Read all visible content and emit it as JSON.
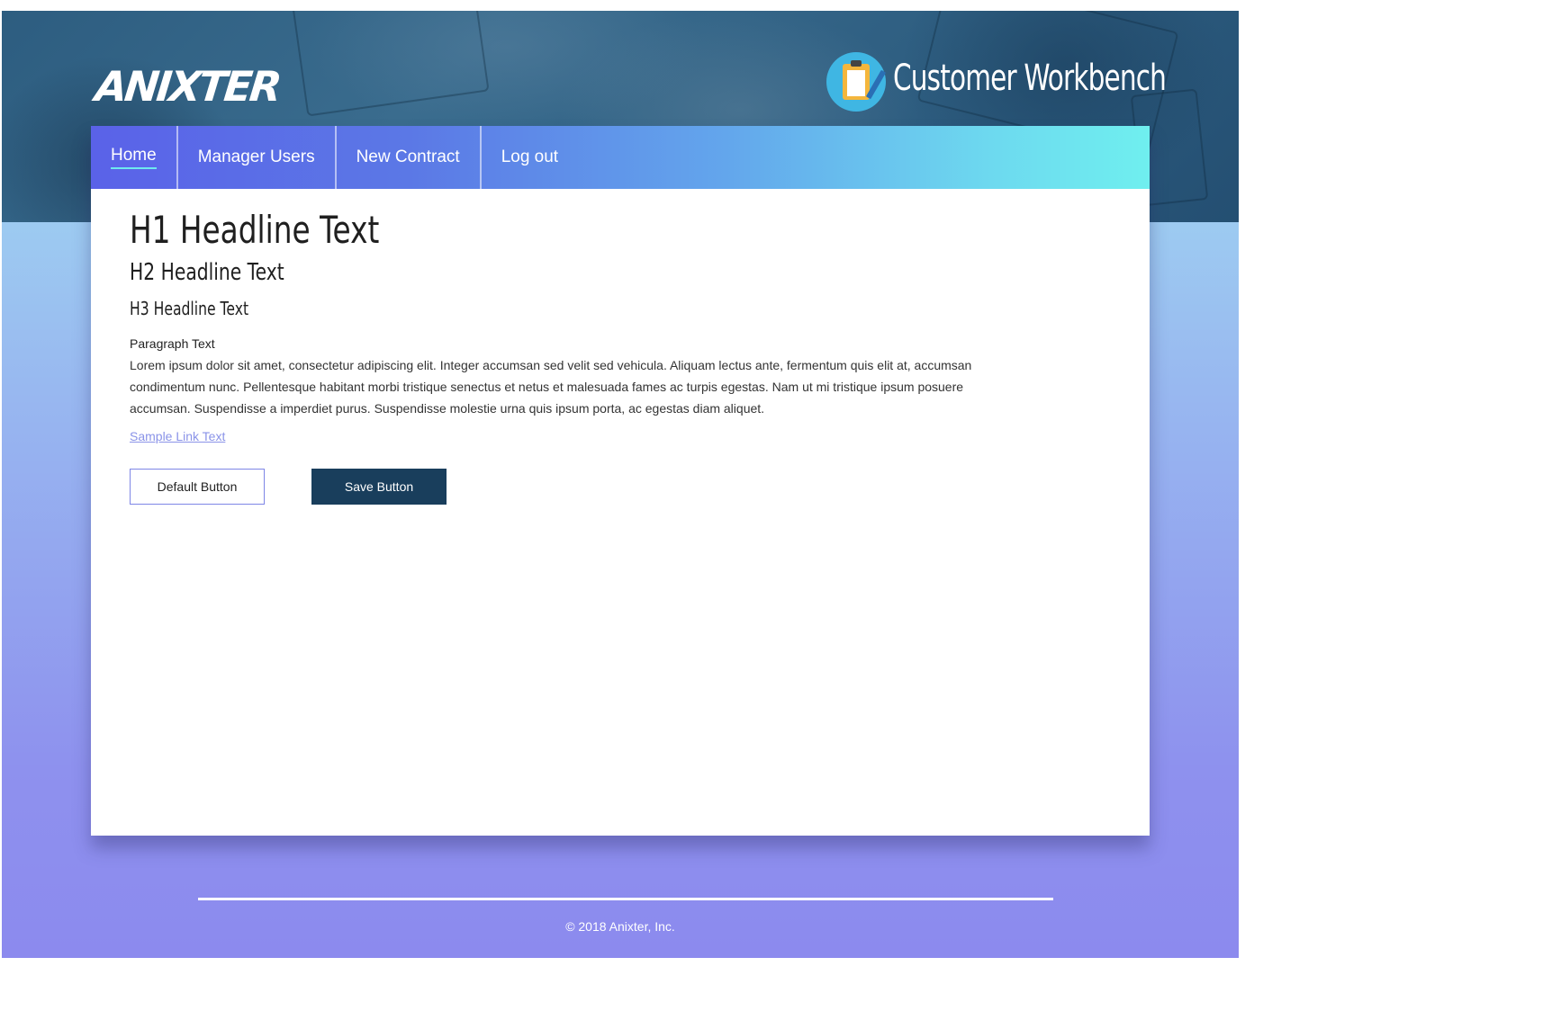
{
  "header": {
    "logo_text": "ANIXTER",
    "app_title": "Customer Workbench",
    "app_icon": "clipboard-icon"
  },
  "nav": {
    "items": [
      {
        "label": "Home",
        "active": true
      },
      {
        "label": "Manager Users",
        "active": false
      },
      {
        "label": "New Contract",
        "active": false
      },
      {
        "label": "Log out",
        "active": false
      }
    ]
  },
  "content": {
    "h1": "H1 Headline Text",
    "h2": "H2 Headline Text",
    "h3": "H3 Headline Text",
    "paragraph_label": "Paragraph Text",
    "paragraph": "Lorem ipsum dolor sit amet, consectetur adipiscing elit. Integer accumsan sed velit sed vehicula. Aliquam lectus ante, fermentum quis elit at, accumsan condimentum nunc. Pellentesque habitant morbi tristique senectus et netus et malesuada fames ac turpis egestas. Nam ut mi tristique ipsum posuere accumsan. Suspendisse a imperdiet purus. Suspendisse molestie urna quis ipsum porta, ac egestas diam aliquet.",
    "link": "Sample Link Text",
    "default_button": "Default Button",
    "save_button": "Save Button"
  },
  "footer": {
    "copyright": "© 2018 Anixter, Inc."
  },
  "colors": {
    "nav_start": "#5a62e8",
    "nav_end": "#6fefef",
    "save_button_bg": "#193e5c",
    "link": "#8a93e8",
    "background_top": "#a3e2f2",
    "background_bottom": "#8c8aee"
  }
}
